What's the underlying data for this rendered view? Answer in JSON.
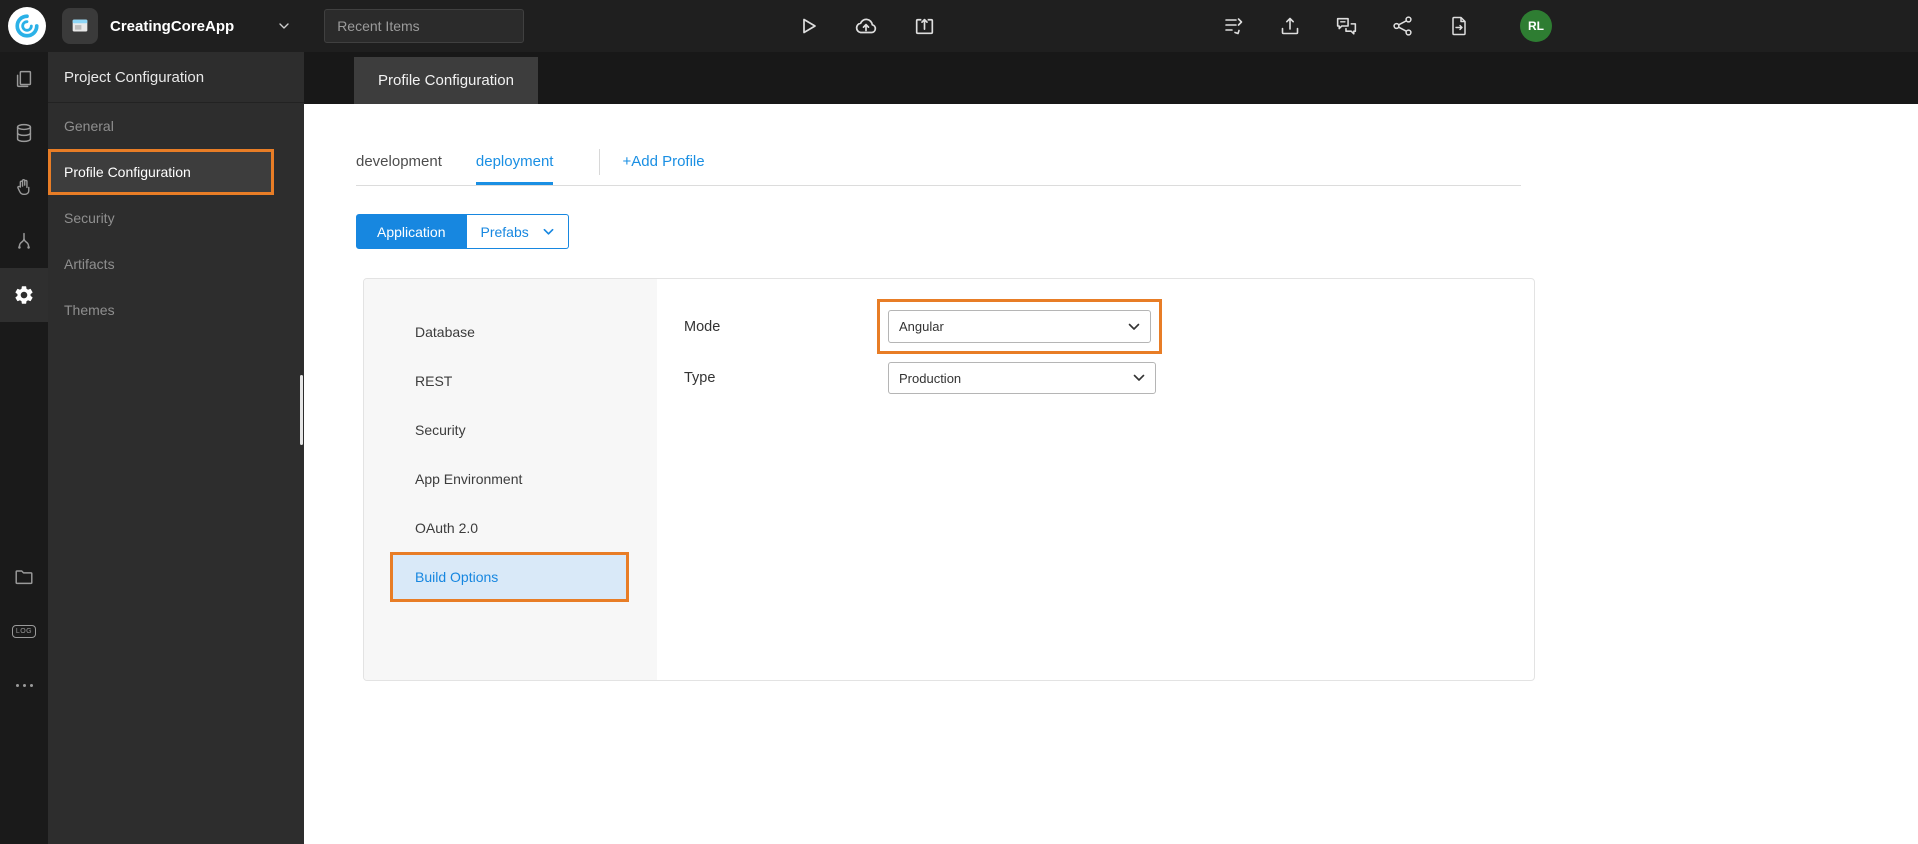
{
  "topbar": {
    "app_name": "CreatingCoreApp",
    "recent_items": "Recent Items",
    "avatar": "RL"
  },
  "rail": {
    "log_label": "LOG"
  },
  "project_panel": {
    "title": "Project Configuration",
    "items": [
      {
        "label": "General"
      },
      {
        "label": "Profile Configuration"
      },
      {
        "label": "Security"
      },
      {
        "label": "Artifacts"
      },
      {
        "label": "Themes"
      }
    ]
  },
  "editor": {
    "tab_label": "Profile Configuration"
  },
  "profiles": {
    "tabs": [
      {
        "label": "development"
      },
      {
        "label": "deployment"
      }
    ],
    "add_profile": "+Add Profile"
  },
  "scope": {
    "application": "Application",
    "prefabs": "Prefabs"
  },
  "settings_nav": [
    {
      "label": "Database"
    },
    {
      "label": "REST"
    },
    {
      "label": "Security"
    },
    {
      "label": "App Environment"
    },
    {
      "label": "OAuth 2.0"
    },
    {
      "label": "Build Options"
    }
  ],
  "form": {
    "mode_label": "Mode",
    "mode_value": "Angular",
    "type_label": "Type",
    "type_value": "Production"
  },
  "colors": {
    "accent_blue": "#1787e0",
    "annotation_orange": "#e87d26",
    "avatar_green": "#2e7d32"
  }
}
